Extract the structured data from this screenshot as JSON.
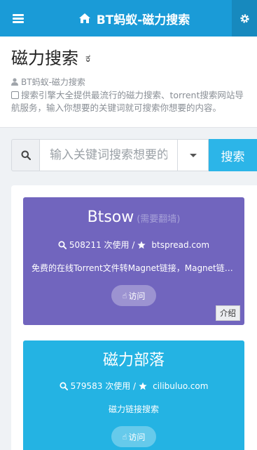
{
  "navbar": {
    "title": "BT蚂蚁-磁力搜索"
  },
  "header": {
    "title": "磁力搜索",
    "emoticon": "ಕ",
    "site_name": "BT蚂蚁-磁力搜索",
    "description": "搜索引擎大全提供最流行的磁力搜索、torrent搜索网站导航服务，输入你想要的关键词就可搜索你想要的内容。"
  },
  "search": {
    "placeholder": "输入关键词搜索想要的内容",
    "button_label": "搜索"
  },
  "cards": [
    {
      "name": "Btsow",
      "subtitle": "(需要翻墙)",
      "uses": "508211 次使用 /",
      "domain": "btspread.com",
      "description": "免费的在线Torrent文件转Magnet链接，Magnet链接转Torrent文件",
      "visit_label": "访问",
      "intro_label": "介绍",
      "color": "#7165be"
    },
    {
      "name": "磁力部落",
      "uses": "579583 次使用 /",
      "domain": "cilibuluo.com",
      "description": "磁力链接搜索",
      "visit_label": "访问",
      "color": "#24b3e3"
    }
  ],
  "icons": {
    "menu": "hamburger-icon",
    "home": "home-icon",
    "settings": "gear-icon",
    "search": "search-icon",
    "star": "star-icon",
    "user": "user-icon",
    "check": "check-square-icon",
    "hand": "hand-pointer-icon"
  }
}
